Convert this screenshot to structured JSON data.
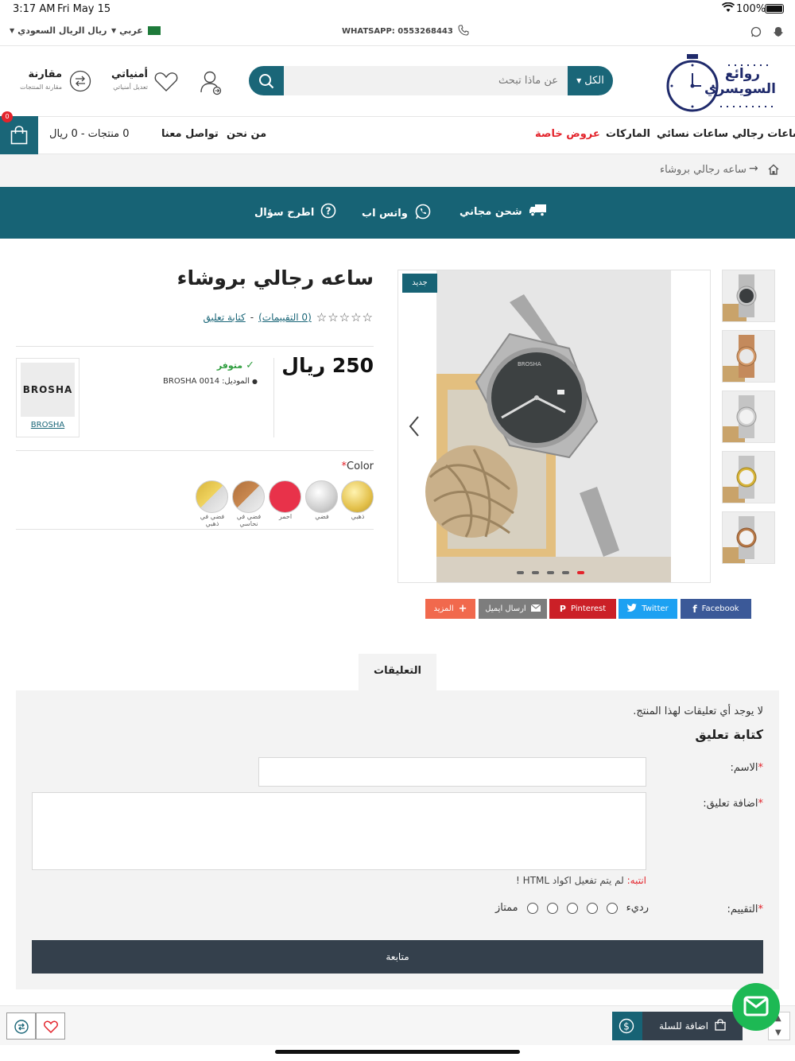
{
  "status_bar": {
    "time": "3:17 AM",
    "date": "Fri May 15",
    "battery": "100%"
  },
  "top_bar": {
    "currency": "ريال الريال السعودي",
    "language": "عربي",
    "whatsapp": "WHATSAPP: 0553268443"
  },
  "header": {
    "logo_text": "روائع السويسري",
    "search": {
      "placeholder": "عن ماذا تبحث",
      "category": "الكل"
    },
    "wishlist": {
      "title": "أمنياتي",
      "subtitle": "تعديل أمنياتي"
    },
    "compare": {
      "title": "مقارنة",
      "subtitle": "مقارنة المنتجات"
    }
  },
  "nav": {
    "items": [
      "ساعات رجالي",
      "ساعات نسائي",
      "الماركات",
      "عروض خاصة"
    ],
    "links": [
      "من نحن",
      "تواصل معنا"
    ],
    "cart_summary": "0 منتجات - 0 ريال",
    "cart_count": "0"
  },
  "breadcrumb": {
    "current": "ساعه رجالي بروشاء"
  },
  "info_bar": {
    "shipping": "شحن مجاني",
    "whatsapp": "واتس اب",
    "question": "اطرح سؤال"
  },
  "product": {
    "badge": "جديد",
    "title": "ساعه رجالي بروشاء",
    "reviews_link": "(0 التقييمات)",
    "separator": "-",
    "write_review": "كتابة تعليق",
    "price": "250 ريال",
    "stock": "متوفر",
    "model_label": "الموديل:",
    "model": "BROSHA 0014",
    "brand_logo": "BROSHA",
    "brand_link": "BROSHA",
    "color_label": "Color",
    "colors": [
      {
        "label": "ذهبي",
        "color": "#e8c84a"
      },
      {
        "label": "فضي",
        "color": "#d4d4d4"
      },
      {
        "label": "احمر",
        "color": "#e8324a"
      },
      {
        "label": "فضي في نحاسي",
        "color": "#b87a48"
      },
      {
        "label": "فضي في ذهبي",
        "color": "#d8b43a"
      }
    ],
    "image_dots": 5,
    "active_dot": 5
  },
  "share": {
    "facebook": "Facebook",
    "twitter": "Twitter",
    "pinterest": "Pinterest",
    "email": "ارسال ايميل",
    "more": "المزيد"
  },
  "reviews": {
    "tab": "التعليقات",
    "empty": "لا يوجد أي تعليقات لهذا المنتج.",
    "form_title": "كتابة تعليق",
    "name_label": "الاسم:",
    "comment_label": "اضافة تعليق:",
    "note_label": "انتبه:",
    "note_text": "لم يتم تفعيل اكواد HTML !",
    "rating_label": "التقييم:",
    "rating_bad": "ردي‌ء",
    "rating_good": "ممتاز",
    "submit": "متابعة"
  },
  "bottom_bar": {
    "add_to_cart": "اضافة للسلة"
  },
  "colors": {
    "primary": "#176375",
    "accent_red": "#e3232b",
    "button_dark": "#34404c"
  }
}
